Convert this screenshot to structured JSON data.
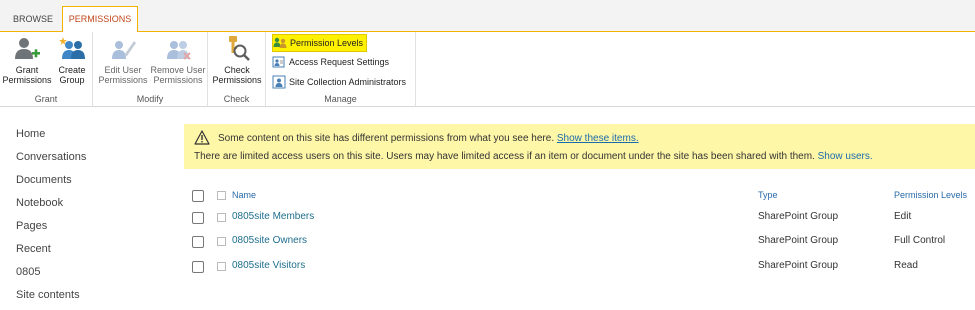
{
  "tabs": [
    {
      "label": "BROWSE"
    },
    {
      "label": "PERMISSIONS"
    }
  ],
  "ribbon": {
    "groups": {
      "grant": {
        "label": "Grant",
        "buttons": [
          {
            "label": "Grant\nPermissions",
            "icon": "grant-permissions-icon"
          },
          {
            "label": "Create\nGroup",
            "icon": "create-group-icon"
          }
        ]
      },
      "modify": {
        "label": "Modify",
        "buttons": [
          {
            "label": "Edit User\nPermissions",
            "icon": "edit-user-permissions-icon"
          },
          {
            "label": "Remove User\nPermissions",
            "icon": "remove-user-permissions-icon"
          }
        ]
      },
      "check": {
        "label": "Check",
        "buttons": [
          {
            "label": "Check\nPermissions",
            "icon": "check-permissions-icon"
          }
        ]
      },
      "manage": {
        "label": "Manage",
        "buttons": [
          {
            "label": "Permission Levels",
            "icon": "permission-levels-icon"
          },
          {
            "label": "Access Request Settings",
            "icon": "access-request-icon"
          },
          {
            "label": "Site Collection Administrators",
            "icon": "site-admins-icon"
          }
        ]
      }
    }
  },
  "nav": {
    "items": [
      {
        "label": "Home"
      },
      {
        "label": "Conversations"
      },
      {
        "label": "Documents"
      },
      {
        "label": "Notebook"
      },
      {
        "label": "Pages"
      },
      {
        "label": "Recent"
      },
      {
        "label": "0805"
      },
      {
        "label": "Site contents"
      }
    ]
  },
  "banner": {
    "text1": "Some content on this site has different permissions from what you see here.",
    "link1": "Show these items.",
    "text2": "There are limited access users on this site. Users may have limited access if an item or document under the site has been shared with them.",
    "link2": "Show users."
  },
  "table": {
    "headers": {
      "name": "Name",
      "type": "Type",
      "level": "Permission Levels"
    },
    "rows": [
      {
        "name": "0805site Members",
        "type": "SharePoint Group",
        "level": "Edit"
      },
      {
        "name": "0805site Owners",
        "type": "SharePoint Group",
        "level": "Full Control"
      },
      {
        "name": "0805site Visitors",
        "type": "SharePoint Group",
        "level": "Read"
      }
    ]
  },
  "colors": {
    "accent_tab": "#c1471c",
    "tab_border": "#f3b200",
    "banner_bg": "#fff7a8",
    "highlight": "#fff100",
    "link": "#1a6bab"
  }
}
